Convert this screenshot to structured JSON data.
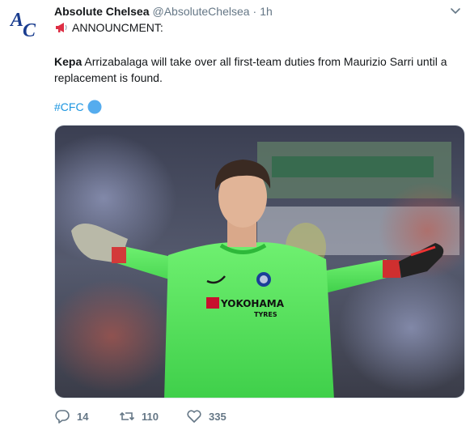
{
  "author": {
    "display_name": "Absolute Chelsea",
    "handle": "@AbsoluteChelsea",
    "separator": "·",
    "time": "1h",
    "avatar_text": "AC",
    "avatar_color": "#1a3d8f"
  },
  "tweet": {
    "line1": "ANNOUNCMENT:",
    "line1_icon": "megaphone-icon",
    "bold_word": "Kepa",
    "line2_rest": " Arrizabalaga will take over all first-team duties from Maurizio Sarri until a",
    "line3": "replacement is found.",
    "hashtag": "#CFC",
    "hashtag_icon": "blue-circle-icon",
    "hashtag_color": "#1b95e0"
  },
  "media": {
    "jersey_text": "YOKOHAMA",
    "jersey_subtext": "TYRES",
    "jersey_color": "#57e05a"
  },
  "actions": {
    "reply_count": "14",
    "retweet_count": "110",
    "like_count": "335"
  }
}
